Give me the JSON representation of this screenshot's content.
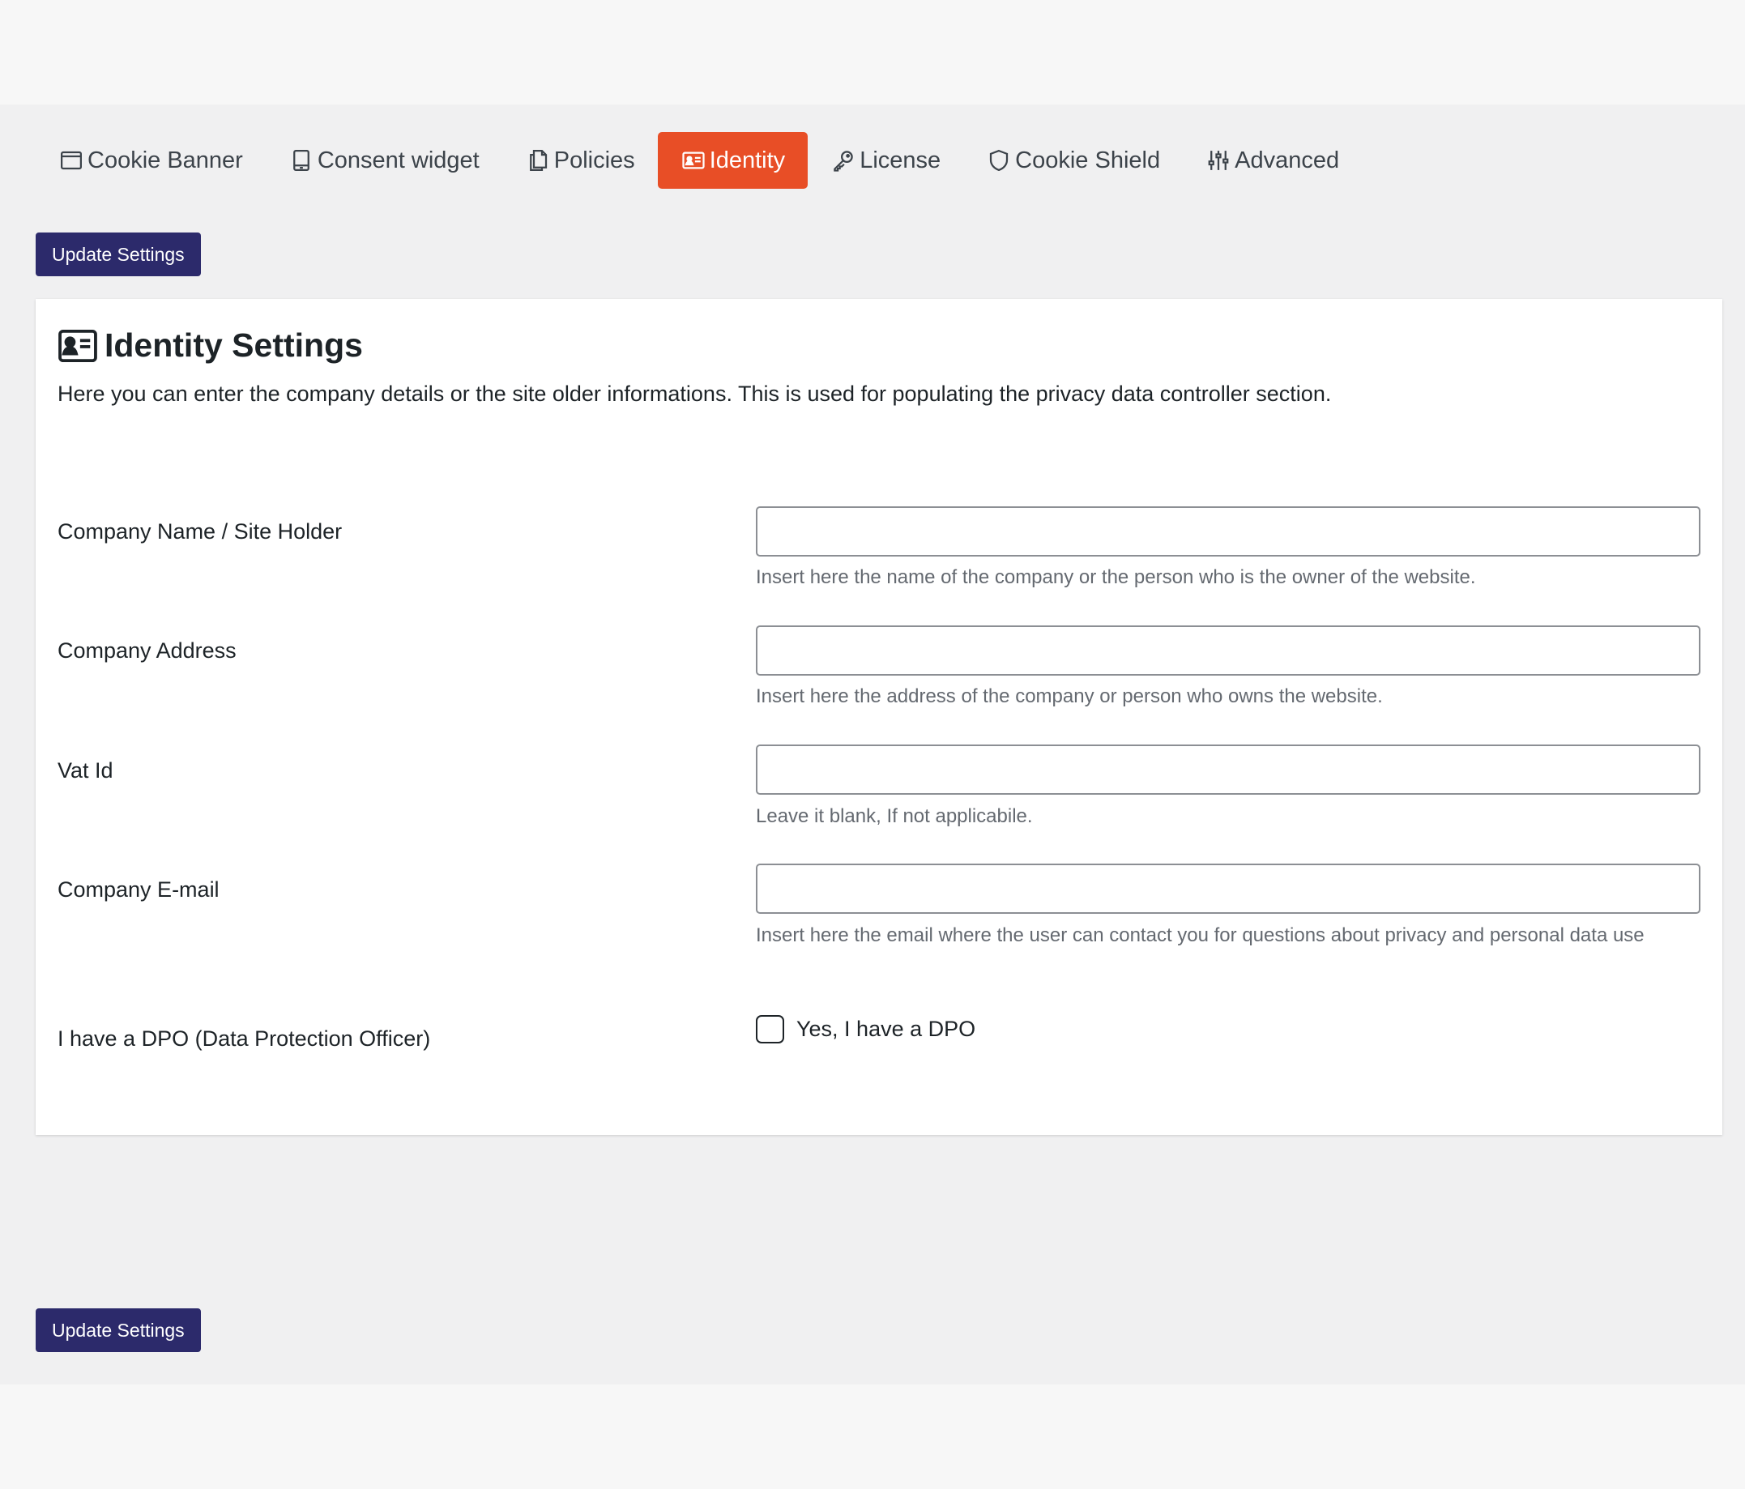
{
  "tabs": [
    {
      "label": "Cookie Banner",
      "icon": "window-icon",
      "active": false
    },
    {
      "label": "Consent widget",
      "icon": "tablet-icon",
      "active": false
    },
    {
      "label": "Policies",
      "icon": "files-icon",
      "active": false
    },
    {
      "label": "Identity",
      "icon": "id-card-icon",
      "active": true
    },
    {
      "label": "License",
      "icon": "key-icon",
      "active": false
    },
    {
      "label": "Cookie Shield",
      "icon": "shield-icon",
      "active": false
    },
    {
      "label": "Advanced",
      "icon": "sliders-icon",
      "active": false
    }
  ],
  "actions": {
    "update_top": "Update Settings",
    "update_bottom": "Update Settings"
  },
  "card": {
    "title": "Identity Settings",
    "title_icon": "id-card-icon",
    "description": "Here you can enter the company details or the site older informations. This is used for populating the privacy data controller section."
  },
  "fields": {
    "company_name": {
      "label": "Company Name / Site Holder",
      "value": "",
      "hint": "Insert here the name of the company or the person who is the owner of the website."
    },
    "company_address": {
      "label": "Company Address",
      "value": "",
      "hint": "Insert here the address of the company or person who owns the website."
    },
    "vat_id": {
      "label": "Vat Id",
      "value": "",
      "hint": "Leave it blank, If not applicabile."
    },
    "company_email": {
      "label": "Company E-mail",
      "value": "",
      "hint": "Insert here the email where the user can contact you for questions about privacy and personal data use"
    },
    "dpo": {
      "label": "I have a DPO (Data Protection Officer)",
      "checkbox_label": "Yes, I have a DPO",
      "checked": false
    }
  },
  "colors": {
    "active_tab": "#e84e26",
    "button": "#2c2a6b",
    "page_bg": "#f0f0f1"
  }
}
